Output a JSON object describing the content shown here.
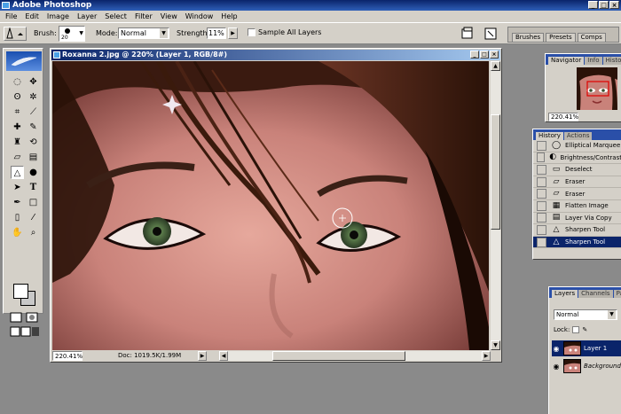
{
  "app": {
    "title": "Adobe Photoshop"
  },
  "menu": [
    "File",
    "Edit",
    "Image",
    "Layer",
    "Select",
    "Filter",
    "View",
    "Window",
    "Help"
  ],
  "options": {
    "brush_label": "Brush:",
    "brush_size": "20",
    "mode_label": "Mode:",
    "mode_value": "Normal",
    "strength_label": "Strength:",
    "strength_value": "11%",
    "sample_label": "Sample All Layers",
    "palette_tabs": [
      "Brushes",
      "Presets",
      "Comps"
    ]
  },
  "document": {
    "title": "Roxanna 2.jpg @ 220% (Layer 1, RGB/8#)",
    "zoom": "220.41%",
    "doc_size": "Doc: 1019.5K/1.99M"
  },
  "navigator": {
    "tabs": [
      "Navigator",
      "Info",
      "Histo"
    ],
    "zoom": "220.41%"
  },
  "history": {
    "tabs": [
      "History",
      "Actions"
    ],
    "items": [
      {
        "label": "Elliptical Marquee",
        "icon": "ellipse-marquee-icon",
        "glyph": "◯"
      },
      {
        "label": "Brightness/Contrast",
        "icon": "adjustment-icon",
        "glyph": "◐"
      },
      {
        "label": "Deselect",
        "icon": "deselect-icon",
        "glyph": "▭"
      },
      {
        "label": "Eraser",
        "icon": "eraser-icon",
        "glyph": "▱"
      },
      {
        "label": "Eraser",
        "icon": "eraser-icon",
        "glyph": "▱"
      },
      {
        "label": "Flatten Image",
        "icon": "flatten-icon",
        "glyph": "▦"
      },
      {
        "label": "Layer Via Copy",
        "icon": "layer-copy-icon",
        "glyph": "▤"
      },
      {
        "label": "Sharpen Tool",
        "icon": "sharpen-icon",
        "glyph": "△"
      },
      {
        "label": "Sharpen Tool",
        "icon": "sharpen-icon",
        "glyph": "△",
        "active": true
      }
    ]
  },
  "layers": {
    "tabs": [
      "Layers",
      "Channels",
      "Paths"
    ],
    "blend_mode": "Normal",
    "lock_label": "Lock:",
    "items": [
      {
        "name": "Layer 1",
        "selected": true
      },
      {
        "name": "Background",
        "selected": false
      }
    ]
  },
  "colors": {
    "title_blue": "#0a246a",
    "chrome": "#d4d0c8",
    "workspace": "#8a8a8a"
  }
}
